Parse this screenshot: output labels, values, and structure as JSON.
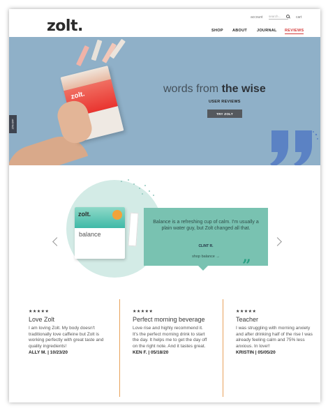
{
  "header": {
    "logo": "zolt.",
    "account": "account",
    "search_placeholder": "search...",
    "cart": "cart",
    "nav": [
      "SHOP",
      "ABOUT",
      "JOURNAL",
      "REVIEWS"
    ]
  },
  "hero": {
    "side_tab": "15% OFF",
    "title_light": "words from ",
    "title_bold": "the wise",
    "subtitle": "USER REVIEWS",
    "cta": "TRY ZOLT",
    "product_brand": "zolt."
  },
  "featured": {
    "product_brand": "zolt.",
    "product_name": "balance",
    "quote": "Balance is a refreshing cup of calm. I'm usually a plain water guy, but Zolt changed all that.",
    "author": "CLINT R.",
    "link": "shop balance →",
    "quote_mark": "”"
  },
  "reviews": [
    {
      "stars": "★★★★★",
      "title": "Love Zolt",
      "body": "I am loving Zolt. My body doesn't traditionally love caffeine but Zolt is working perfectly with great taste and quality ingredients!",
      "author": "ALLY M. | 10/23/20"
    },
    {
      "stars": "★★★★★",
      "title": "Perfect morning beverage",
      "body": "Love rise and highly recommend it. It's the perfect morning drink to start the day. It helps me to get the day off on the right note. And it tastes great.",
      "author": "KEN F. | 05/18/20"
    },
    {
      "stars": "★★★★★",
      "title": "Teacher",
      "body": "I was struggling with morning anxiety and after drinking half of the rise I was already feeling calm and 75% less anxious. In love!!",
      "author": "KRISTIN | 05/05/20"
    }
  ],
  "colors": {
    "hero_bg": "#8fb0c8",
    "card_teal": "#79c2b1",
    "accent_red": "#d43a3a",
    "quote_blue": "#5b82c4",
    "divider": "#e8a15a"
  }
}
